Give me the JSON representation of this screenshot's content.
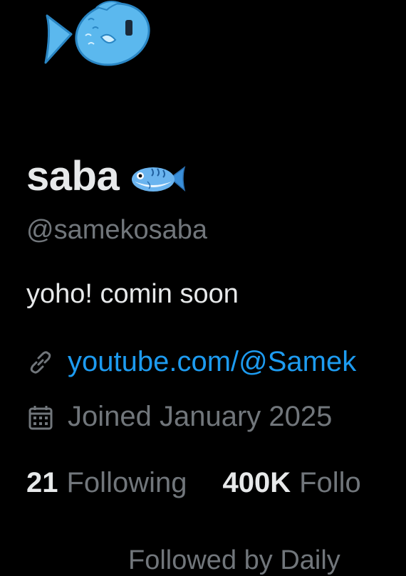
{
  "profile": {
    "avatar_icon": "blue-fish-icon",
    "display_name": "saba",
    "name_emoji_icon": "fish-emoji-icon",
    "handle": "@samekosaba",
    "bio": "yoho! comin soon",
    "link_icon": "link-icon",
    "link": "youtube.com/@Samek",
    "calendar_icon": "calendar-icon",
    "joined": "Joined January 2025"
  },
  "stats": {
    "following_count": "21",
    "following_label": "Following",
    "followers_count": "400K",
    "followers_label": "Follo"
  },
  "footer": {
    "followed_by": "Followed by Daily"
  },
  "colors": {
    "background": "#000000",
    "text_primary": "#e7e9ea",
    "text_secondary": "#71767b",
    "link": "#1d9bf0",
    "fish": "#5bb8ee"
  }
}
